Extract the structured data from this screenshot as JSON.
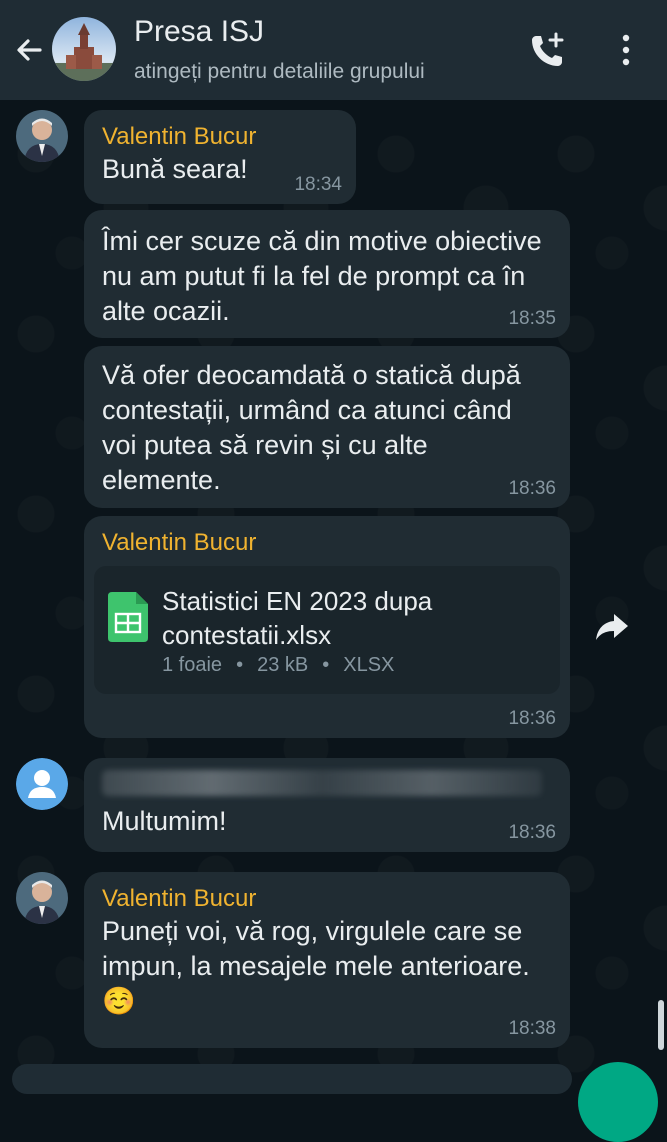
{
  "header": {
    "title": "Presa ISJ",
    "subtitle": "atingeți pentru detaliile grupului"
  },
  "messages": [
    {
      "sender": "Valentin Bucur",
      "text": "Bună seara!",
      "time": "18:34"
    },
    {
      "text": "Îmi cer scuze că din motive obiective nu am putut fi la fel de prompt ca în alte ocazii.",
      "time": "18:35"
    },
    {
      "text": "Vă ofer deocamdată o statică după contestații, urmând ca atunci când voi putea să revin și cu alte elemente.",
      "time": "18:36"
    },
    {
      "sender": "Valentin Bucur",
      "file": {
        "name": "Statistici EN 2023 dupa contestatii.xlsx",
        "pages": "1 foaie",
        "size": "23 kB",
        "type": "XLSX"
      },
      "time": "18:36"
    },
    {
      "text": "Multumim!",
      "time": "18:36"
    },
    {
      "sender": "Valentin Bucur",
      "text": "Puneți voi, vă rog, virgulele care se impun, la mesajele mele anterioare. ☺️",
      "time": "18:38"
    }
  ],
  "colors": {
    "accent": "#00a884",
    "sender": "#f0b330",
    "bubble": "#202c33",
    "header": "#1f2c34"
  }
}
